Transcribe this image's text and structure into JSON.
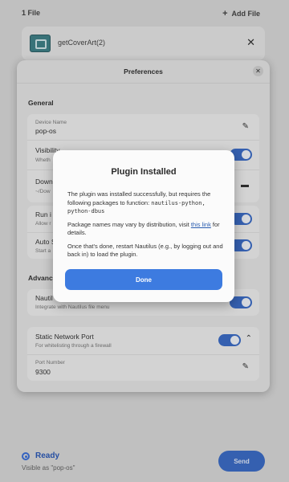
{
  "header": {
    "file_count": "1 File",
    "add_file": "Add File"
  },
  "file": {
    "name": "getCoverArt(2)"
  },
  "status": {
    "title": "Ready",
    "subtitle": "Visible as \"pop-os\""
  },
  "send_label": "Send",
  "preferences": {
    "title": "Preferences",
    "general_label": "General",
    "device_name_label": "Device Name",
    "device_name_value": "pop-os",
    "visibility_title": "Visibility",
    "visibility_sub": "Wheth",
    "downloads_title": "Downl",
    "downloads_sub": "~/Dow",
    "run_title": "Run i",
    "run_sub": "Allow r",
    "auto_title": "Auto S",
    "auto_sub": "Start a",
    "advanced_label": "Advanc",
    "nautilus_title": "Nautil",
    "nautilus_sub": "Integrate with Nautilus file menu",
    "static_port_title": "Static Network Port",
    "static_port_sub": "For whitelisting through a firewall",
    "port_number_label": "Port Number",
    "port_number_value": "9300"
  },
  "modal": {
    "title": "Plugin Installed",
    "p1": "The plugin was installed successfully, but requires the following packages to function: ",
    "packages": "nautilus-python, python-dbus",
    "p2_a": "Package names may vary by distribution, visit ",
    "p2_link": "this link",
    "p2_b": " for details.",
    "p3": "Once that's done, restart Nautilus (e.g., by logging out and back in) to load the plugin.",
    "done_label": "Done"
  },
  "colors": {
    "accent": "#3d7be0",
    "toggle_on": "#3b6bc4"
  },
  "icons": [
    "plus-icon",
    "close-icon",
    "pencil-icon",
    "folder-icon",
    "chevron-up-icon",
    "status-icon",
    "file-thumbnail-icon"
  ]
}
